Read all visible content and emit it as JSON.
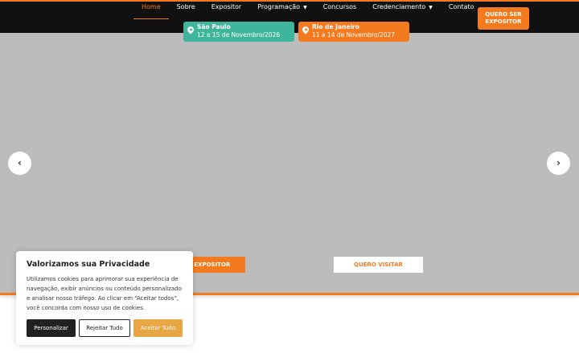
{
  "nav": {
    "items": [
      {
        "label": "Home"
      },
      {
        "label": "Sobre"
      },
      {
        "label": "Expositor"
      },
      {
        "label": "Programação"
      },
      {
        "label": "Concursos"
      },
      {
        "label": "Credenciamento"
      },
      {
        "label": "Contato"
      }
    ],
    "cta_label": "QUERO SER EXPOSITOR"
  },
  "locations": [
    {
      "city": "São Paulo",
      "dates": "12 a 15 de Novembro/2026"
    },
    {
      "city": "Rio de Janeiro",
      "dates": "11 a 14 de Novembro/2027"
    }
  ],
  "hero": {
    "prev_glyph": "‹",
    "next_glyph": "›",
    "btn_expositor": "ER EXPOSITOR",
    "btn_visitar": "QUERO VISITAR"
  },
  "cookie": {
    "title": "Valorizamos sua Privacidade",
    "text": "Utilizamos cookies para aprimorar sua experiência de navegação, exibir anúncios ou conteúdo personalizado e analisar nosso tráfego. Ao clicar em “Aceitar todos”, você concorda com nosso uso de cookies.",
    "customize": "Personalizar",
    "reject": "Rejeitar Tudo",
    "accept": "Aceitar Tudo"
  },
  "colors": {
    "accent": "#f47a20",
    "teal": "#3fb59c",
    "header_bg": "#111111",
    "hero_bg": "#bcbcbc",
    "accept_btn": "#e9a645"
  },
  "icons": [
    "map-pin-icon",
    "chevron-down-icon",
    "chevron-left-icon",
    "chevron-right-icon"
  ]
}
